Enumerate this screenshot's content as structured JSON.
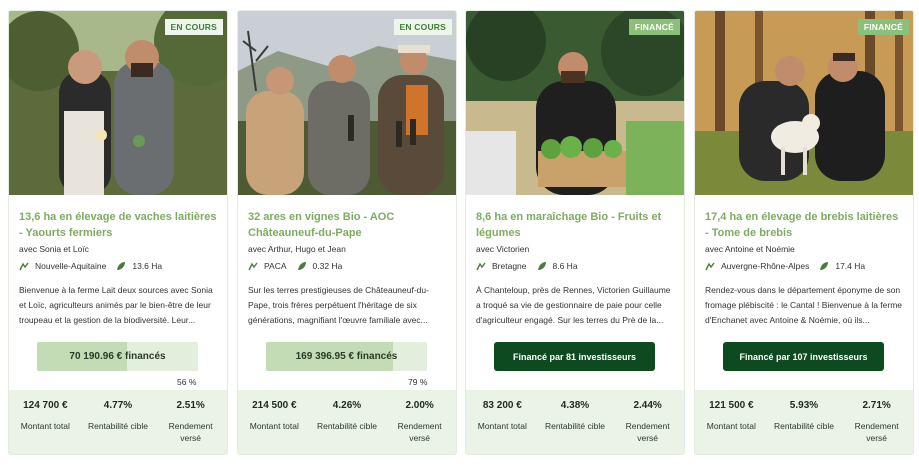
{
  "cards": [
    {
      "badge": "EN COURS",
      "title": "13,6 ha en élevage de vaches laitières - Yaourts fermiers",
      "farmers": "avec Sonia et Loïc",
      "region": "Nouvelle-Aquitaine",
      "area": "13.6 Ha",
      "description": "Bienvenue à la ferme Lait deux sources avec Sonia et Loïc, agriculteurs animés par le bien-être de leur troupeau et la gestion de la biodiversité. Leur...",
      "funded_label": "70 190.96 € financés",
      "funded_percent": 56,
      "percent_label": "56 %",
      "stats": {
        "amount": "124 700 €",
        "target": "4.77%",
        "paid": "2.51%"
      }
    },
    {
      "badge": "EN COURS",
      "title": "32 ares en vignes Bio - AOC Châteauneuf-du-Pape",
      "farmers": "avec Arthur, Hugo et Jean",
      "region": "PACA",
      "area": "0.32 Ha",
      "description": "Sur les terres prestigieuses de Châteauneuf-du-Pape, trois frères perpétuent l'héritage de six générations, magnifiant l'œuvre familiale avec...",
      "funded_label": "169 396.95 € financés",
      "funded_percent": 79,
      "percent_label": "79 %",
      "stats": {
        "amount": "214 500 €",
        "target": "4.26%",
        "paid": "2.00%"
      }
    },
    {
      "badge": "FINANCÉ",
      "title": "8,6 ha en maraîchage Bio - Fruits et légumes",
      "farmers": "avec Victorien",
      "region": "Bretagne",
      "area": "8.6 Ha",
      "description": "À Chanteloup, près de Rennes, Victorien Guillaume a troqué sa vie de gestionnaire de paie pour celle d'agriculteur engagé. Sur les terres du Prè de la...",
      "button_label": "Financé par 81 investisseurs",
      "stats": {
        "amount": "83 200 €",
        "target": "4.38%",
        "paid": "2.44%"
      }
    },
    {
      "badge": "FINANCÉ",
      "title": "17,4 ha en élevage de brebis laitières - Tome de brebis",
      "farmers": "avec Antoine et Noémie",
      "region": "Auvergne-Rhône-Alpes",
      "area": "17.4 Ha",
      "description": "Rendez-vous dans le département éponyme de son fromage plébiscité : le Cantal ! Bienvenue à la ferme d'Enchanet avec Antoine & Noémie, où ils...",
      "button_label": "Financé par 107 investisseurs",
      "stats": {
        "amount": "121 500 €",
        "target": "5.93%",
        "paid": "2.71%"
      }
    }
  ],
  "labels": {
    "amount": "Montant total",
    "target": "Rentabilité cible",
    "paid": "Rendement versé"
  },
  "colors": {
    "accent": "#7cad5e",
    "button": "#0d4a1f",
    "stats_bg": "#eaf3e5"
  }
}
